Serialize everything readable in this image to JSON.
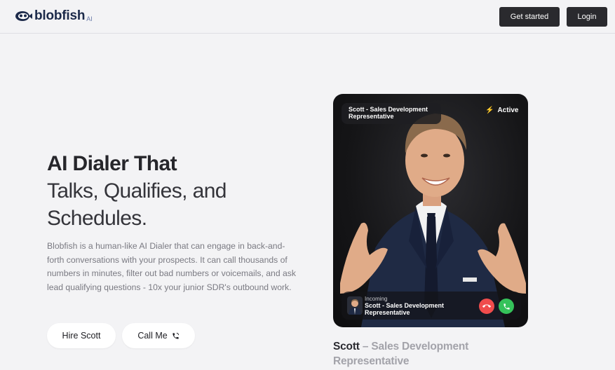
{
  "brand": {
    "name": "blobfish",
    "suffix": "AI"
  },
  "nav": {
    "get_started": "Get started",
    "login": "Login"
  },
  "hero": {
    "title_line1": "AI Dialer That",
    "title_line2": "Talks, Qualifies, and",
    "title_line3": "Schedules.",
    "description": "Blobfish is a human-like AI Dialer that can engage in back-and-forth conversations with your prospects. It can call thousands of numbers in minutes, filter out bad numbers or voicemails, and ask lead qualifying questions - 10x your junior SDR's outbound work.",
    "hire_button": "Hire Scott",
    "call_button": "Call Me"
  },
  "agent_card": {
    "name_chip": "Scott - Sales Development Representative",
    "status": "Active",
    "incoming_label": "Incoming",
    "incoming_name": "Scott - Sales Development Representative"
  },
  "caption": {
    "name": "Scott",
    "role": " – Sales Development Representative"
  },
  "colors": {
    "background": "#f3f3f5",
    "dark_button": "#2a2a2e",
    "decline": "#f04c4c",
    "accept": "#35c25a",
    "active_bolt": "#f7c948"
  },
  "icons": [
    "blobfish-logo-icon",
    "phone-icon",
    "bolt-icon",
    "phone-hangup-icon",
    "phone-accept-icon"
  ]
}
